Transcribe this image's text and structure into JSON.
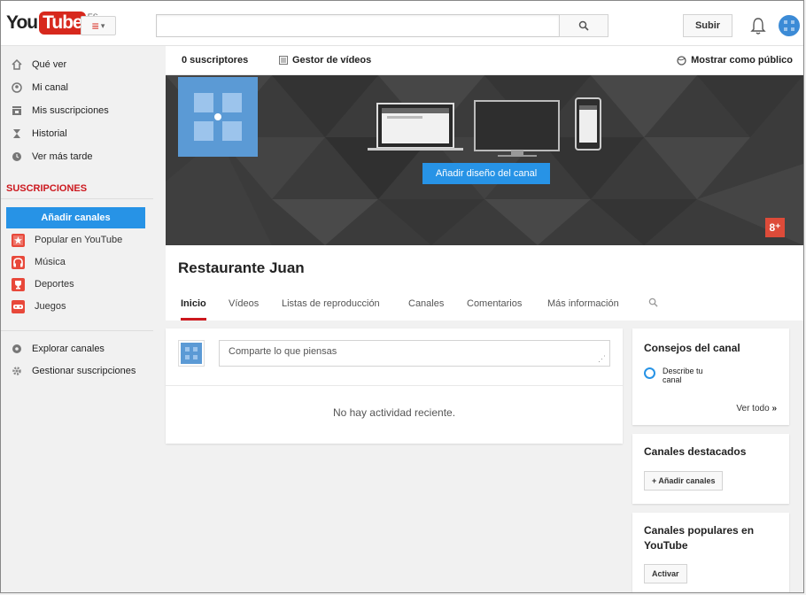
{
  "header": {
    "logo_you": "You",
    "logo_tube": "Tube",
    "logo_region": "ES",
    "search_value": "",
    "upload_label": "Subir"
  },
  "sidebar": {
    "nav": [
      {
        "label": "Qué ver",
        "icon": "home-icon"
      },
      {
        "label": "Mi canal",
        "icon": "user-icon"
      },
      {
        "label": "Mis suscripciones",
        "icon": "subscriptions-icon"
      },
      {
        "label": "Historial",
        "icon": "hourglass-icon"
      },
      {
        "label": "Ver más tarde",
        "icon": "clock-icon"
      }
    ],
    "subs_title": "SUSCRIPCIONES",
    "add_channels": "Añadir canales",
    "subs": [
      {
        "label": "Popular en YouTube",
        "color": "#e8483a"
      },
      {
        "label": "Música",
        "color": "#e8483a"
      },
      {
        "label": "Deportes",
        "color": "#e8483a"
      },
      {
        "label": "Juegos",
        "color": "#e8483a"
      }
    ],
    "bottom": [
      {
        "label": "Explorar canales",
        "icon": "explore-icon"
      },
      {
        "label": "Gestionar suscripciones",
        "icon": "gear-icon"
      }
    ]
  },
  "owner_bar": {
    "subscribers": "0 suscriptores",
    "video_manager": "Gestor de vídeos",
    "view_as_public": "Mostrar como público"
  },
  "banner": {
    "design_button": "Añadir diseño del canal",
    "gplus": "8⁺"
  },
  "channel": {
    "name": "Restaurante Juan",
    "tabs": [
      "Inicio",
      "Vídeos",
      "Listas de reproducción",
      "Canales",
      "Comentarios",
      "Más información"
    ]
  },
  "feed": {
    "placeholder": "Comparte lo que piensas",
    "empty": "No hay actividad reciente."
  },
  "right": {
    "tips_title": "Consejos del canal",
    "tip": "Describe tu canal",
    "see_all": "Ver todo",
    "featured_title": "Canales destacados",
    "featured_button": "+ Añadir canales",
    "popular_title": "Canales populares en YouTube",
    "popular_button": "Activar"
  },
  "colors": {
    "accent": "#2793e6",
    "brand_red": "#cc181e",
    "channel_avatar": "#5b9ad5"
  }
}
